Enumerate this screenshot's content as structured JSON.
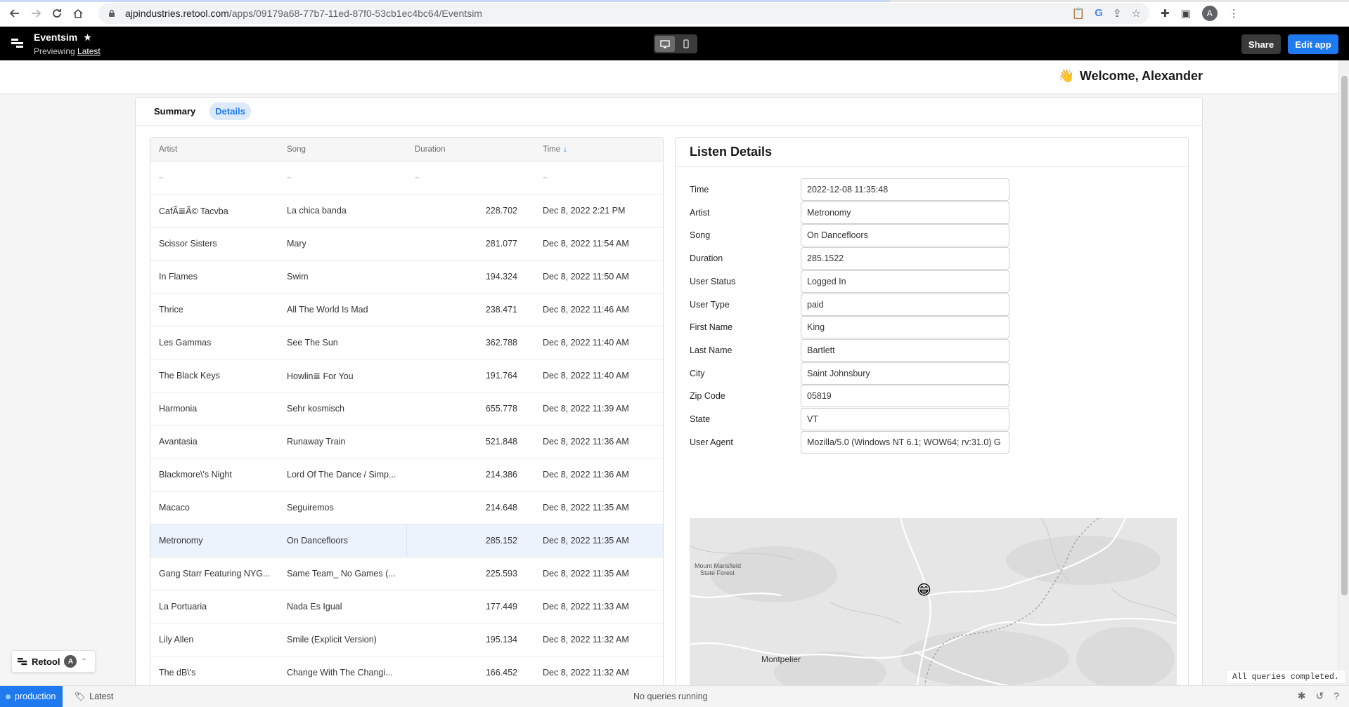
{
  "browser": {
    "url_host": "ajpindustries.retool.com",
    "url_path": "/apps/09179a68-77b7-11ed-87f0-53cb1ec4bc64/Eventsim",
    "profile_initial": "A"
  },
  "header": {
    "app_name": "Eventsim",
    "previewing_label": "Previewing",
    "version_link": "Latest",
    "share_label": "Share",
    "edit_label": "Edit app"
  },
  "welcome": {
    "emoji": "👋",
    "text": "Welcome, Alexander"
  },
  "tabs": [
    {
      "label": "Summary",
      "active": false
    },
    {
      "label": "Details",
      "active": true
    }
  ],
  "table": {
    "columns": [
      "Artist",
      "Song",
      "Duration",
      "Time"
    ],
    "sort_indicator": "↓",
    "placeholder": "–",
    "rows": [
      {
        "artist": "CafÃ≣Ã© Tacvba",
        "song": "La chica banda",
        "duration": "228.702",
        "time": "Dec 8, 2022 2:21 PM",
        "selected": false
      },
      {
        "artist": "Scissor Sisters",
        "song": "Mary",
        "duration": "281.077",
        "time": "Dec 8, 2022 11:54 AM",
        "selected": false
      },
      {
        "artist": "In Flames",
        "song": "Swim",
        "duration": "194.324",
        "time": "Dec 8, 2022 11:50 AM",
        "selected": false
      },
      {
        "artist": "Thrice",
        "song": "All The World Is Mad",
        "duration": "238.471",
        "time": "Dec 8, 2022 11:46 AM",
        "selected": false
      },
      {
        "artist": "Les Gammas",
        "song": "See The Sun",
        "duration": "362.788",
        "time": "Dec 8, 2022 11:40 AM",
        "selected": false
      },
      {
        "artist": "The Black Keys",
        "song": "Howlin≣ For You",
        "duration": "191.764",
        "time": "Dec 8, 2022 11:40 AM",
        "selected": false
      },
      {
        "artist": "Harmonia",
        "song": "Sehr kosmisch",
        "duration": "655.778",
        "time": "Dec 8, 2022 11:39 AM",
        "selected": false
      },
      {
        "artist": "Avantasia",
        "song": "Runaway Train",
        "duration": "521.848",
        "time": "Dec 8, 2022 11:36 AM",
        "selected": false
      },
      {
        "artist": "Blackmore\\'s Night",
        "song": "Lord Of The Dance / Simp...",
        "duration": "214.386",
        "time": "Dec 8, 2022 11:36 AM",
        "selected": false
      },
      {
        "artist": "Macaco",
        "song": "Seguiremos",
        "duration": "214.648",
        "time": "Dec 8, 2022 11:35 AM",
        "selected": false
      },
      {
        "artist": "Metronomy",
        "song": "On Dancefloors",
        "duration": "285.152",
        "time": "Dec 8, 2022 11:35 AM",
        "selected": true
      },
      {
        "artist": "Gang Starr Featuring NYG...",
        "song": "Same Team_ No Games (...",
        "duration": "225.593",
        "time": "Dec 8, 2022 11:35 AM",
        "selected": false
      },
      {
        "artist": "La Portuaria",
        "song": "Nada Es Igual",
        "duration": "177.449",
        "time": "Dec 8, 2022 11:33 AM",
        "selected": false
      },
      {
        "artist": "Lily Allen",
        "song": "Smile (Explicit Version)",
        "duration": "195.134",
        "time": "Dec 8, 2022 11:32 AM",
        "selected": false
      },
      {
        "artist": "The dB\\'s",
        "song": "Change With The Changi...",
        "duration": "166.452",
        "time": "Dec 8, 2022 11:32 AM",
        "selected": false
      }
    ]
  },
  "details": {
    "title": "Listen Details",
    "fields": [
      {
        "label": "Time",
        "value": "2022-12-08 11:35:48"
      },
      {
        "label": "Artist",
        "value": "Metronomy"
      },
      {
        "label": "Song",
        "value": "On Dancefloors"
      },
      {
        "label": "Duration",
        "value": "285.1522"
      },
      {
        "label": "User Status",
        "value": "Logged In"
      },
      {
        "label": "User Type",
        "value": "paid"
      },
      {
        "label": "First Name",
        "value": "King"
      },
      {
        "label": "Last Name",
        "value": "Bartlett"
      },
      {
        "label": "City",
        "value": "Saint Johnsbury"
      },
      {
        "label": "Zip Code",
        "value": "05819"
      },
      {
        "label": "State",
        "value": "VT"
      },
      {
        "label": "User Agent",
        "value": "Mozilla/5.0 (Windows NT 6.1; WOW64; rv:31.0) G"
      }
    ],
    "map": {
      "label_forest": "Mount Mansfield State Forest",
      "label_city": "Montpelier",
      "marker": "😁"
    }
  },
  "footer": {
    "retool_label": "Retool",
    "retool_avatar": "A",
    "queries_toast": "All queries completed.",
    "env_label": "production",
    "branch_label": "Latest",
    "queries_status": "No queries running"
  }
}
